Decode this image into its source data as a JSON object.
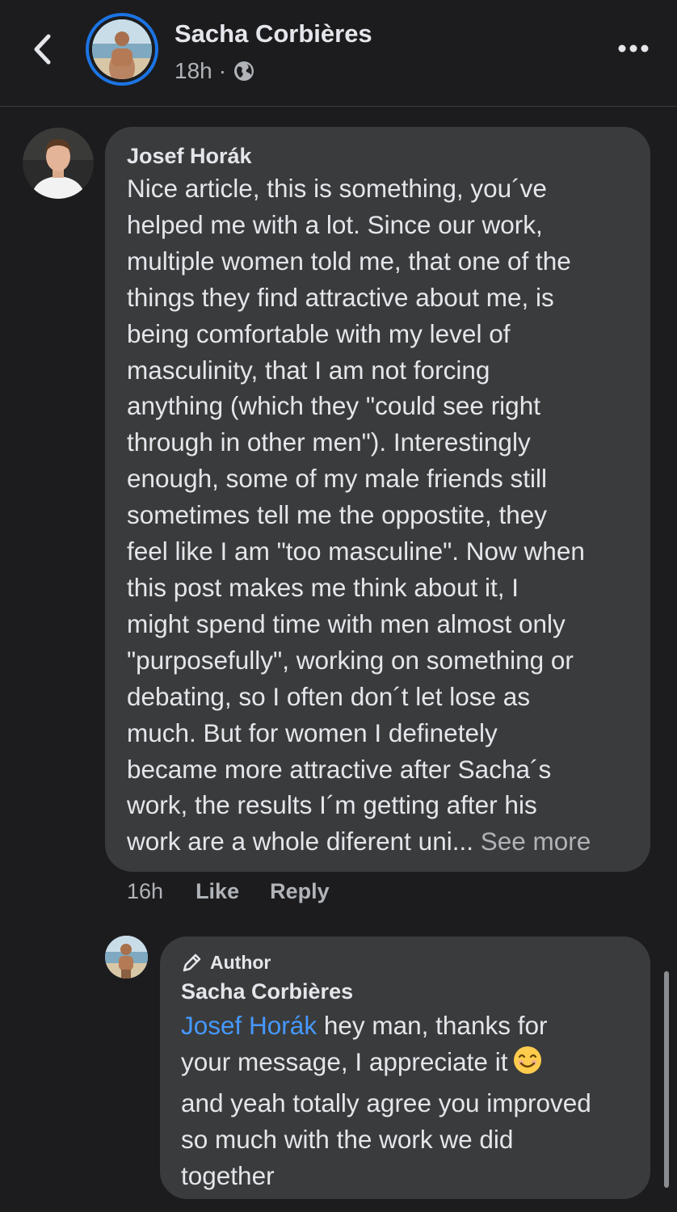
{
  "header": {
    "name": "Sacha Corbières",
    "time": "18h",
    "separator": "·",
    "privacy_icon": "globe-icon",
    "back_icon": "chevron-left-icon",
    "more_icon": "ellipsis-icon"
  },
  "comment": {
    "author": "Josef Horák",
    "lines": [
      "Nice article, this is something, you´ve",
      "helped me with a lot. Since our work,",
      "multiple women told me, that one of the",
      "things they find attractive about me, is",
      "being comfortable with my level of",
      "masculinity, that I am not forcing",
      "anything (which they \"could see right",
      "through in other men\"). Interestingly",
      "enough, some of my male friends still",
      "sometimes tell me the oppostite, they",
      "feel like I am \"too masculine\". Now when",
      "this post makes me think about it, I",
      "might spend time with men almost only",
      "\"purposefully\", working on something or",
      "debating, so I often don´t let lose as",
      "much. But for women I definetely",
      "became more attractive after Sacha´s",
      "work, the results I´m getting after his"
    ],
    "last_line": "work are a whole diferent uni...",
    "see_more": "See more",
    "time": "16h",
    "like_label": "Like",
    "reply_label": "Reply"
  },
  "reply": {
    "badge": "Author",
    "author": "Sacha Corbières",
    "mention": "Josef Horák",
    "line1_rest": " hey man, thanks for",
    "line2": "your message, I appreciate it",
    "emoji": "😊",
    "line3": "and yeah totally agree you improved",
    "line4": "so much with the work we did",
    "line5": "together"
  },
  "colors": {
    "background": "#1c1c1e",
    "bubble": "#3a3b3c",
    "text": "#e4e6eb",
    "secondary": "#b0b3b8",
    "link": "#4599ff",
    "accent_ring": "#1b74e4"
  }
}
